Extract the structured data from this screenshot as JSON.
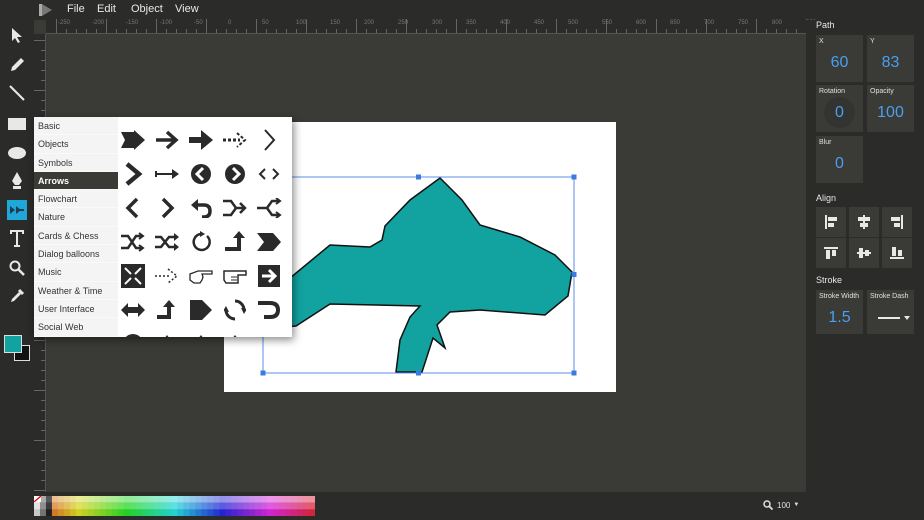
{
  "menu": {
    "file": "File",
    "edit": "Edit",
    "object": "Object",
    "view": "View"
  },
  "ruler_labels": [
    "-250",
    "-200",
    "-150",
    "-100",
    "-50",
    "0",
    "50",
    "100",
    "150",
    "200",
    "250",
    "300",
    "350",
    "400",
    "450",
    "500",
    "550",
    "600",
    "650",
    "700",
    "750",
    "800",
    "850"
  ],
  "shape_library": {
    "categories": [
      "Basic",
      "Objects",
      "Symbols",
      "Arrows",
      "Flowchart",
      "Nature",
      "Cards & Chess",
      "Dialog balloons",
      "Music",
      "Weather & Time",
      "User Interface",
      "Social Web"
    ],
    "active_category": "Arrows"
  },
  "panel": {
    "path_heading": "Path",
    "x_label": "X",
    "x_value": "60",
    "y_label": "Y",
    "y_value": "83",
    "rotation_label": "Rotation",
    "rotation_value": "0",
    "opacity_label": "Opacity",
    "opacity_value": "100",
    "blur_label": "Blur",
    "blur_value": "0",
    "align_heading": "Align",
    "stroke_heading": "Stroke",
    "stroke_width_label": "Stroke Width",
    "stroke_width_value": "1.5",
    "stroke_dash_label": "Stroke Dash"
  },
  "zoom": {
    "value": "100"
  },
  "colors": {
    "fill": "#12a3a0",
    "stroke": "#111111",
    "accent": "#1fa7d9",
    "selection": "#3b7be0"
  },
  "icons": {
    "tools": [
      "select-arrow-icon",
      "pencil-icon",
      "line-icon",
      "rectangle-icon",
      "ellipse-icon",
      "pen-icon",
      "shapelib-icon",
      "text-icon",
      "zoom-icon",
      "eyedropper-icon"
    ],
    "align": [
      "align-left-icon",
      "align-center-icon",
      "align-right-icon",
      "align-top-icon",
      "align-middle-icon",
      "align-bottom-icon"
    ]
  }
}
